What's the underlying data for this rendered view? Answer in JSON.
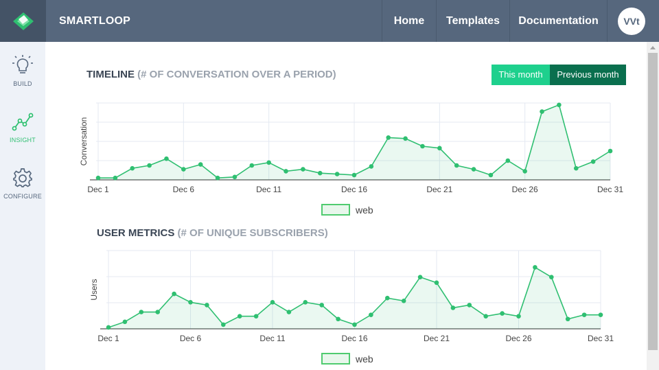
{
  "app": {
    "brand": "SMARTLOOP",
    "avatar_initials": "VVt",
    "accent": "#2fbf71"
  },
  "nav": {
    "home": "Home",
    "templates": "Templates",
    "documentation": "Documentation"
  },
  "sidebar": {
    "build": "BUILD",
    "insight": "INSIGHT",
    "configure": "CONFIGURE"
  },
  "timeline": {
    "title": "TIMELINE",
    "subtitle": "(# OF CONVERSATION OVER A PERIOD)",
    "this_month": "This month",
    "previous_month": "Previous month",
    "ylabel": "Conversation",
    "legend": "web"
  },
  "users": {
    "title": "USER METRICS",
    "subtitle": "(# OF UNIQUE SUBSCRIBERS)",
    "ylabel": "Users",
    "legend": "web"
  },
  "chart_data": [
    {
      "type": "area",
      "title": "TIMELINE (# OF CONVERSATION OVER A PERIOD)",
      "ylabel": "Conversation",
      "x_ticks": [
        "Dec 1",
        "Dec 6",
        "Dec 11",
        "Dec 16",
        "Dec 21",
        "Dec 26",
        "Dec 31"
      ],
      "x": [
        1,
        2,
        3,
        4,
        5,
        6,
        7,
        8,
        9,
        10,
        11,
        12,
        13,
        14,
        15,
        16,
        17,
        18,
        19,
        20,
        21,
        22,
        23,
        24,
        25,
        26,
        27,
        28,
        29,
        30,
        31
      ],
      "series": [
        {
          "name": "web",
          "values": [
            1,
            1,
            6,
            7.5,
            11,
            5.5,
            8,
            1,
            1.5,
            7.5,
            9,
            4.5,
            5.5,
            3.5,
            3,
            2.5,
            7,
            22,
            21.5,
            17.5,
            16.5,
            7.5,
            5.5,
            2.5,
            10,
            4.5,
            35.5,
            39,
            6,
            9.5,
            15
          ]
        }
      ],
      "ylim": [
        0,
        40
      ],
      "grid": true,
      "legend": "bottom-center",
      "color": "#2fbf71"
    },
    {
      "type": "area",
      "title": "USER METRICS (# OF UNIQUE SUBSCRIBERS)",
      "ylabel": "Users",
      "x_ticks": [
        "Dec 1",
        "Dec 6",
        "Dec 11",
        "Dec 16",
        "Dec 21",
        "Dec 26",
        "Dec 31"
      ],
      "x": [
        1,
        2,
        3,
        4,
        5,
        6,
        7,
        8,
        9,
        10,
        11,
        12,
        13,
        14,
        15,
        16,
        17,
        18,
        19,
        20,
        21,
        22,
        23,
        24,
        25,
        26,
        27,
        28,
        29,
        30,
        31
      ],
      "series": [
        {
          "name": "web",
          "values": [
            0.5,
            2.5,
            6,
            6,
            12.5,
            9.5,
            8.5,
            1.5,
            4.5,
            4.5,
            9.5,
            6,
            9.5,
            8.5,
            3.5,
            1.5,
            5,
            11,
            10,
            18.5,
            16.5,
            7.5,
            8.5,
            4.5,
            5.5,
            4.5,
            22,
            18.5,
            3.5,
            5,
            5
          ]
        }
      ],
      "ylim": [
        0,
        28
      ],
      "grid": true,
      "legend": "bottom-center",
      "color": "#2fbf71"
    }
  ]
}
